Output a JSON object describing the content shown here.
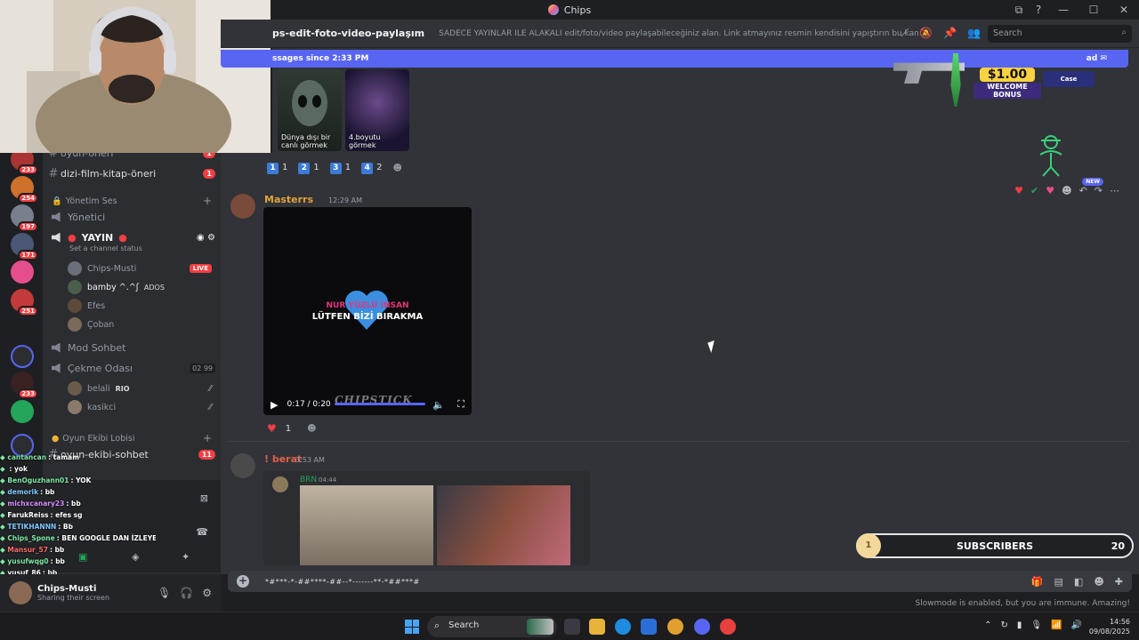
{
  "window": {
    "title": "Chips",
    "controls": [
      "⧉",
      "?",
      "—",
      "☐",
      "✕"
    ]
  },
  "header": {
    "channel_name": "ps-edit-foto-video-paylaşım",
    "topic": "SADECE YAYINLAR İLE ALAKALI edit/foto/video paylaşabileceğiniz alan. Link atmayınız resmin kendisini yapıştırın bu kanala lütfen, ...",
    "search_placeholder": "Search"
  },
  "new_messages_bar": {
    "text": "ssages since 2:33 PM",
    "mark_label": "ad"
  },
  "servers": [
    {
      "badge": ""
    },
    {
      "badge": "233"
    },
    {
      "badge": "254"
    },
    {
      "badge": "197"
    },
    {
      "badge": "171"
    },
    {
      "badge": ""
    },
    {
      "badge": "251"
    },
    {
      "badge": ""
    },
    {
      "badge": "233"
    },
    {
      "badge": ""
    },
    {
      "badge": ""
    }
  ],
  "sidebar": {
    "channels_top": [
      {
        "name": "oyun-öneri",
        "badge": "1"
      },
      {
        "name": "dizi-film-kitap-öneri",
        "badge": "1"
      }
    ],
    "category_voice": "Yönetim Ses",
    "voice_channels": [
      {
        "name": "Yönetici"
      },
      {
        "name": "YAYIN"
      }
    ],
    "channel_status": "Set a channel status",
    "voice_users": [
      {
        "name": "Chips-Musti",
        "tag": "LIVE"
      },
      {
        "name": "bamby ^.^ʃ",
        "tag": "ADOS"
      },
      {
        "name": "Efes",
        "tag": ""
      },
      {
        "name": "Çoban",
        "tag": ""
      }
    ],
    "mod_channel": "Mod Sohbet",
    "pull_channel": {
      "name": "Çekme Odası",
      "count_a": "02",
      "count_b": "99"
    },
    "pull_users": [
      {
        "name": "belali",
        "tag": "RIO"
      },
      {
        "name": "kasikci",
        "tag": ""
      }
    ],
    "category_game": "Oyun Ekibi Lobisi",
    "game_channel": {
      "name": "oyun-ekibi-sohbet",
      "badge": "11"
    }
  },
  "chat_overlay": [
    {
      "user": "cantancan",
      "text": ": tamam",
      "color": "#7fe8a3"
    },
    {
      "user": "",
      "text": ": yok",
      "color": "#ff6a6a"
    },
    {
      "user": "BenOguzhann01",
      "text": ": YOK",
      "color": "#7fe8a3"
    },
    {
      "user": "demorik",
      "text": ": bb",
      "color": "#7ec8ff"
    },
    {
      "user": "michxcanary23",
      "text": ": bb",
      "color": "#d78bff"
    },
    {
      "user": "FarukReiss",
      "text": ": efes sg",
      "color": "#ffffff"
    },
    {
      "user": "TETIKHANNN",
      "text": ": Bb",
      "color": "#7ec8ff"
    },
    {
      "user": "Chips_Spone",
      "text": ": BEN GOOGLE DAN İZLEYECEM BB",
      "color": "#7fe8a3"
    },
    {
      "user": "Mansur_57",
      "text": ": bb",
      "color": "#ff6a6a"
    },
    {
      "user": "yusufwqg0",
      "text": ": bb",
      "color": "#7fe8a3"
    },
    {
      "user": "yusuf_86",
      "text": ": bb",
      "color": "#ffffff"
    }
  ],
  "user_panel": {
    "name": "Chips-Musti",
    "status": "Sharing their screen"
  },
  "thumbnails": [
    {
      "caption": "Dünya dışı bir canlı görmek"
    },
    {
      "caption": "4.boyutu görmek"
    }
  ],
  "poll_reactions": [
    {
      "key": "1",
      "count": "1"
    },
    {
      "key": "2",
      "count": "1"
    },
    {
      "key": "3",
      "count": "1"
    },
    {
      "key": "4",
      "count": "2"
    }
  ],
  "messages": [
    {
      "author": "Masterrs",
      "author_color": "#e0a33a",
      "time": "12:29 AM",
      "video": {
        "line1": "NUR YÜZLÜ İNSAN",
        "line2": "LÜTFEN BİZİ BIRAKMA",
        "time": "0:17 / 0:20",
        "watermark": "CHIPSTICK",
        "progress": 0.85
      },
      "reaction_count": "1"
    },
    {
      "author": "! berat",
      "author_color": "#e0604a",
      "time": "3:53 AM",
      "embed_author": "BRN",
      "embed_time": "04:44"
    }
  ],
  "composer": {
    "text": "*#***-*-##****-##--*-------**-*##***#"
  },
  "slowmode": "Slowmode is enabled, but you are immune. Amazing!",
  "promo": {
    "amount": "$1.00",
    "label": "WELCOME BONUS",
    "brand": "Case"
  },
  "subscribers": {
    "label": "SUBSCRIBERS",
    "current": "1",
    "goal": "20"
  },
  "taskbar": {
    "search": "Search",
    "time": "14:56",
    "date": "09/08/2025"
  },
  "colors": {
    "accent": "#5865f2",
    "danger": "#f23f43",
    "bg_main": "#313338",
    "bg_sidebar": "#2b2d31"
  }
}
